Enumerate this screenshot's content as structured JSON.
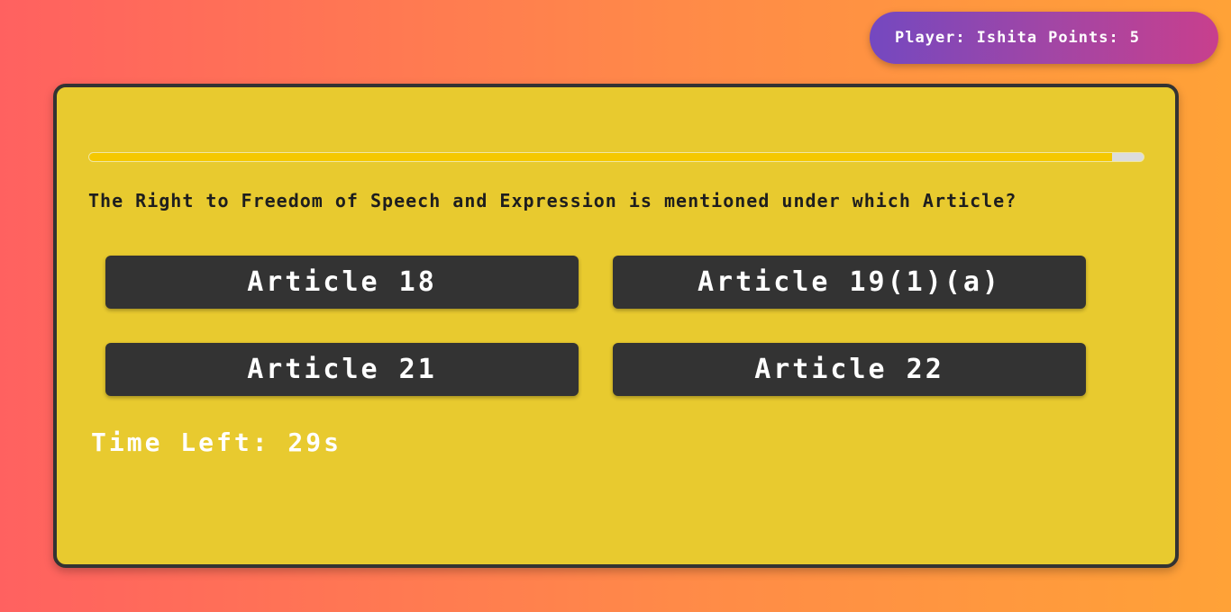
{
  "player": {
    "name_label": "Player:",
    "name": "Ishita",
    "points_label": "Points:",
    "points": "5"
  },
  "quiz": {
    "progress_fraction": 0.97,
    "question": "The Right to Freedom of Speech and Expression is mentioned under which Article?",
    "answers": [
      {
        "label": "Article 18"
      },
      {
        "label": "Article 19(1)(a)"
      },
      {
        "label": "Article 21"
      },
      {
        "label": "Article 22"
      }
    ],
    "timer_label": "Time Left: 29s"
  },
  "colors": {
    "card_background": "#e8ca2f",
    "button_background": "#333333",
    "progress_fill": "#f5c800",
    "badge_gradient_start": "#7448c0",
    "badge_gradient_end": "#c83f8d"
  }
}
